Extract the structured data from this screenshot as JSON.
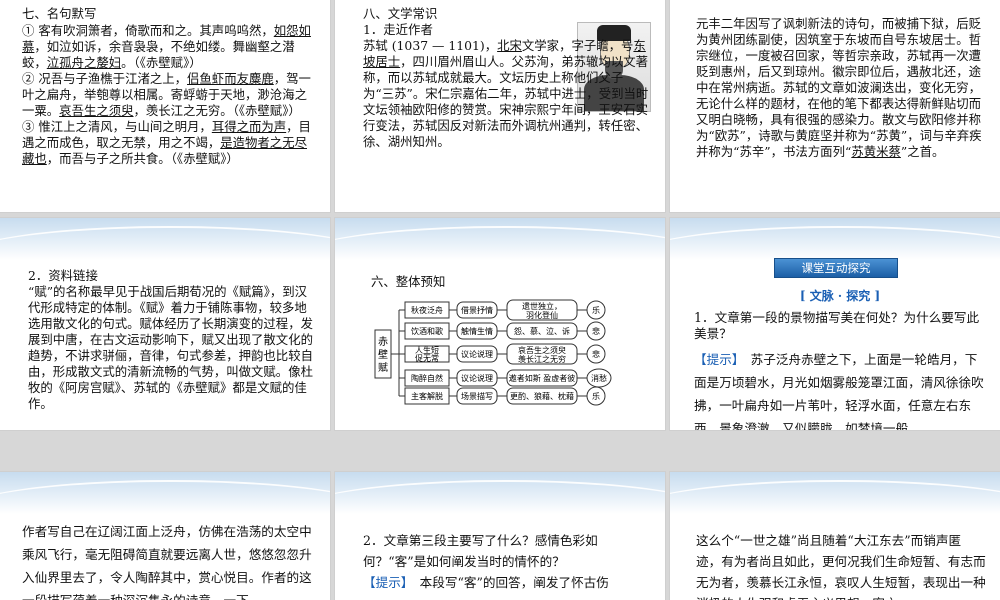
{
  "s1": {
    "heading": "七、名句默写",
    "l1": "① 客有吹洞箫者，倚歌而和之。其声呜呜然，",
    "u1": "如怨如慕",
    "l2": "，如泣如诉，余音袅袅，不绝如缕。舞幽壑之潜蛟，",
    "u2": "泣孤舟之嫠妇",
    "l3": "。（《赤壁赋》）",
    "l4": "② 况吾与子渔樵于江渚之上，",
    "u4": "侣鱼虾而友麋鹿",
    "l5": "，驾一叶之扁舟，举匏尊以相属。寄蜉蝣于天地，渺沧海之一粟。",
    "u5": "哀吾生之须臾",
    "l6": "，羡长江之无穷。（《赤壁赋》）",
    "l7": "③ 惟江上之清风，与山间之明月，",
    "u7": "耳得之而为声",
    "l8": "，目遇之而成色，取之无禁，用之不竭，",
    "u8": "是造物者之无尽藏也",
    "l9": "，而吾与子之所共食。（《赤壁赋》）"
  },
  "s2": {
    "heading": "八、文学常识",
    "sub": "1．走近作者",
    "a1": "苏轼 (1037 — 1101)，",
    "a1u": "北宋",
    "a1b": "文学家，字子瞻，号",
    "a1u2": "东坡居士",
    "a1c": "，四川眉州眉山人。父苏洵，弟苏辙均以文著称，而以苏轼成就最大。文坛历史上称他们父子为“三苏”。宋仁宗嘉佑二年，苏轼中进士，受到当时文坛领袖欧阳修的赞赏。宋神宗熙宁年间，王安石实行变法，苏轼因反对新法而外调杭州通判，转任密、徐、湖州知州。"
  },
  "s3": {
    "t1": "元丰二年因写了讽刺新法的诗句，而被捕下狱，后贬为黄州团练副使，因筑室于东坡而自号东坡居士。哲宗继位，一度被召回家，等哲宗亲政，苏轼再一次遭贬到惠州，后又到琼州。徽宗即位后，遇赦北还，途中在常州病逝。苏轼的文章如波澜迭出，变化无穷，无论什么样的题材，在他的笔下都表达得新鲜贴切而又明白晓畅，具有很强的感染力。散文与欧阳修并称为“欧苏”，诗歌与黄庭坚并称为“苏黄”，词与辛弃疾并称为“苏辛”，书法方面列“",
    "t1u": "苏黄米蔡",
    "t2": "”之首。"
  },
  "s4": {
    "heading": "2．资料链接",
    "body": "“赋”的名称最早见于战国后期荀况的《赋篇》，到汉代形成特定的体制。《赋》着力于铺陈事物，较多地选用散文化的句式。赋体经历了长期演变的过程，发展到中唐，在古文运动影响下，赋又出现了散文化的趋势，不讲求骈俪，音律，句式参差，押韵也比较自由，形成散文式的清新流畅的气势，叫做文赋。像杜牧的《阿房宫赋》、苏轼的《赤壁赋》都是文赋的佳作。"
  },
  "s5": {
    "heading": "六、整体预知",
    "root": "赤壁赋",
    "rows": [
      {
        "a": "秋夜泛舟",
        "b": "借景抒情",
        "c1": "遗世独立，",
        "c2": "羽化登仙",
        "d": "乐"
      },
      {
        "a": "饮酒和歌",
        "b": "触情生情",
        "c1": "怨、慕、泣、诉",
        "c2": "",
        "d": "悲"
      },
      {
        "a1": "人生短",
        "a2": "促无常",
        "b": "议论说理",
        "c1": "哀吾生之须臾",
        "c2": "羡长江之无穷",
        "d": "悲"
      },
      {
        "a": "陶醉自然",
        "b": "议论说理",
        "c1": "遨者如斯 盈虚者彼",
        "c2": "",
        "d": "消愁"
      },
      {
        "a": "主客解脱",
        "b": "场景描写",
        "c1": "更酌、狼藉、枕藉",
        "c2": "",
        "d": "乐"
      }
    ]
  },
  "s6": {
    "badge": "课堂互动探究",
    "sub": "[ 文脉 · 探究 ]",
    "q": "1．文章第一段的景物描写美在何处？为什么要写此美景？",
    "hint": "【提示】",
    "a": "　苏子泛舟赤壁之下，上面是一轮皓月，下面是万顷碧水，月光如烟雾般笼罩江面，清风徐徐吹拂，一叶扁舟如一片苇叶，轻浮水面，任意左右东西。景象澄澈，又似朦胧，如梦境一般。"
  },
  "s7": {
    "body": "作者写自己在辽阔江面上泛舟，仿佛在浩荡的太空中乘风飞行，毫无阻碍简直就要远离人世，悠悠忽忽升入仙界里去了，令人陶醉其中，赏心悦目。作者的这一段描写蕴着一种深沉隽永的诗意，一下"
  },
  "s8": {
    "q": "2．文章第三段主要写了什么？感情色彩如何？“客”是如何阐发当时的情怀的？",
    "hint": "【提示】",
    "a": "　本段写“客”的回答，阐发了怀古伤"
  },
  "s9": {
    "body": "这么个“一世之雄”尚且随着“大江东去”而销声匿迹，有为者尚且如此，更何况我们生命短暂、有志而无为者，羡慕长江永恒，哀叹人生短暂，表现出一种消极的人生观和虚无主义思想。客之"
  }
}
